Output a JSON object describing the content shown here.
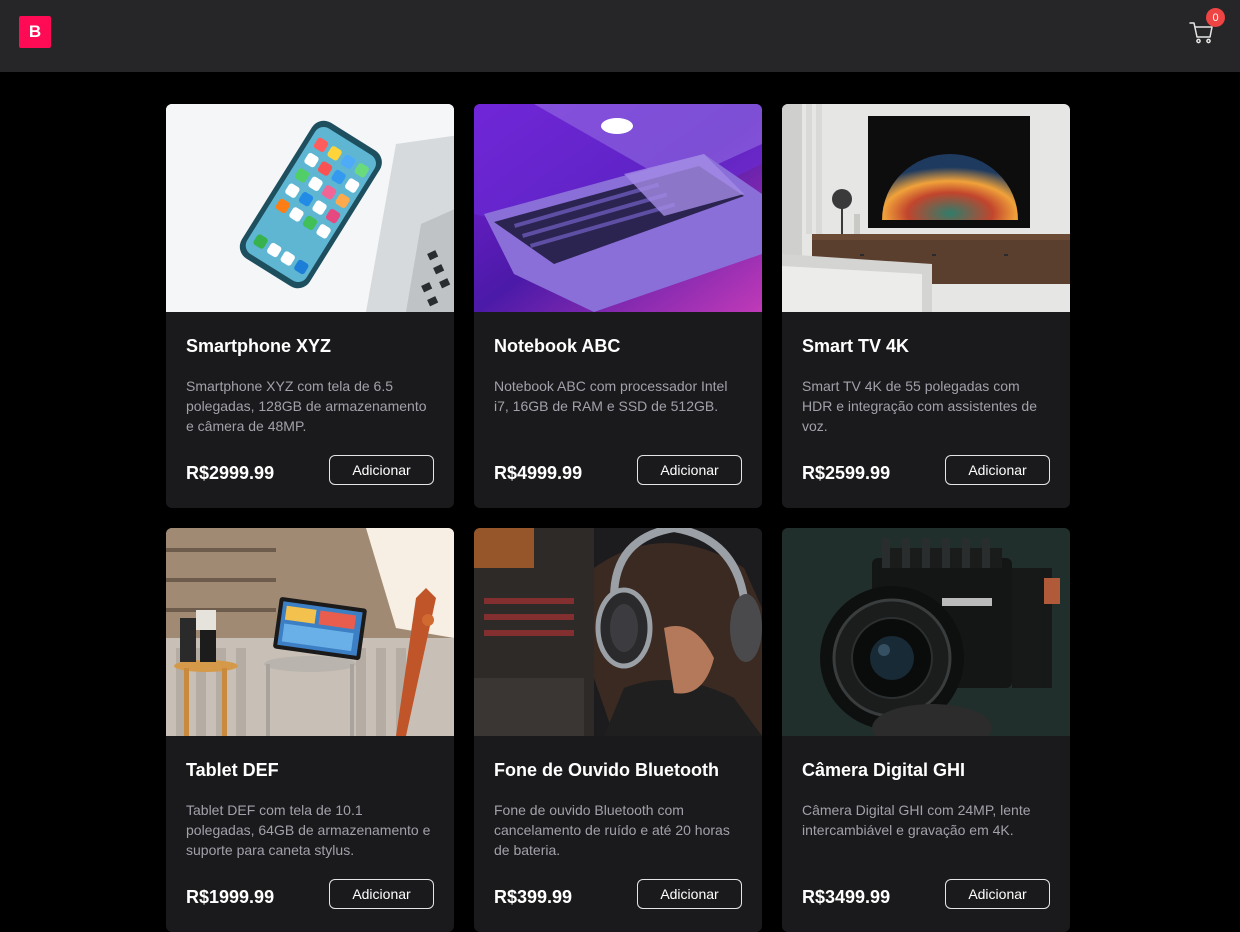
{
  "header": {
    "logo_text": "B",
    "cart_count": "0",
    "accent_color": "#ff0a54",
    "badge_color": "#ef4444"
  },
  "products": [
    {
      "title": "Smartphone XYZ",
      "description": "Smartphone XYZ com tela de 6.5 polegadas, 128GB de armazenamento e câmera de 48MP.",
      "price": "R$2999.99",
      "button_label": "Adicionar",
      "image_icon": "smartphone-photo"
    },
    {
      "title": "Notebook ABC",
      "description": "Notebook ABC com processador Intel i7, 16GB de RAM e SSD de 512GB.",
      "price": "R$4999.99",
      "button_label": "Adicionar",
      "image_icon": "laptop-photo"
    },
    {
      "title": "Smart TV 4K",
      "description": "Smart TV 4K de 55 polegadas com HDR e integração com assistentes de voz.",
      "price": "R$2599.99",
      "button_label": "Adicionar",
      "image_icon": "tv-photo"
    },
    {
      "title": "Tablet DEF",
      "description": "Tablet DEF com tela de 10.1 polegadas, 64GB de armazenamento e suporte para caneta stylus.",
      "price": "R$1999.99",
      "button_label": "Adicionar",
      "image_icon": "tablet-photo"
    },
    {
      "title": "Fone de Ouvido Bluetooth",
      "description": "Fone de ouvido Bluetooth com cancelamento de ruído e até 20 horas de bateria.",
      "price": "R$399.99",
      "button_label": "Adicionar",
      "image_icon": "headphones-photo"
    },
    {
      "title": "Câmera Digital GHI",
      "description": "Câmera Digital GHI com 24MP, lente intercambiável e gravação em 4K.",
      "price": "R$3499.99",
      "button_label": "Adicionar",
      "image_icon": "camera-photo"
    }
  ]
}
